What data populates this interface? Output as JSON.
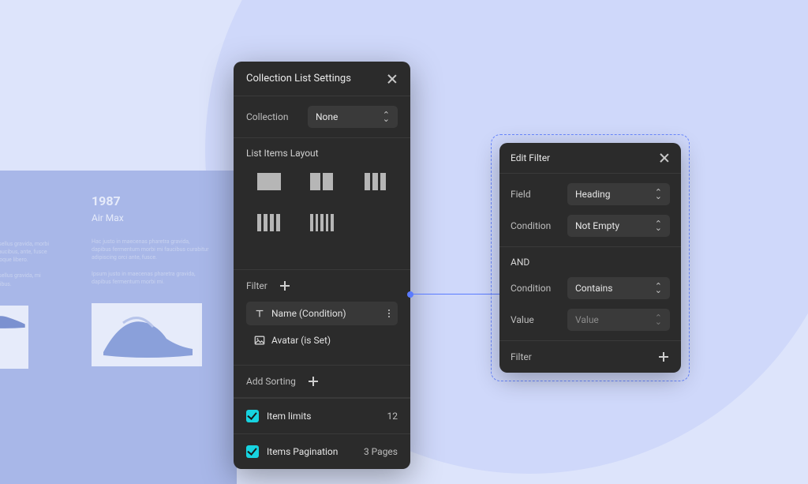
{
  "background": {
    "left_pane": {
      "year": "1987",
      "product": "Air Max",
      "col1_blurb": "Phasellus gravida, morbi mi faucibus, ante, fusce mi soque libero.",
      "col1_blurb2": "Phasellus gravida, mi faucibus.",
      "col2_blurb": "Hac justo in maecenas pharetra gravida, dapibus fermentum morbi mi faucibus curabitur adipiscing orci ante, fusce.",
      "col2_blurb2": "Ipsum justo in maecenas pharetra gravida, dapibus fermentum morbi mi."
    }
  },
  "settings_panel": {
    "title": "Collection List Settings",
    "collection": {
      "label": "Collection",
      "value": "None"
    },
    "list_layout": {
      "label": "List Items Layout"
    },
    "filter": {
      "label": "Filter",
      "items": [
        {
          "icon": "text",
          "label": "Name (Condition)",
          "menu": true
        },
        {
          "icon": "image",
          "label": "Avatar (is Set)",
          "menu": false
        }
      ]
    },
    "sorting": {
      "label": "Add Sorting"
    },
    "item_limits": {
      "label": "Item limits",
      "value": "12"
    },
    "pagination": {
      "label": "Items Pagination",
      "value": "3 Pages"
    }
  },
  "edit_filter": {
    "title": "Edit Filter",
    "field": {
      "label": "Field",
      "value": "Heading"
    },
    "condition1": {
      "label": "Condition",
      "value": "Not Empty"
    },
    "operator": "AND",
    "condition2": {
      "label": "Condition",
      "value": "Contains"
    },
    "value": {
      "label": "Value",
      "placeholder": "Value"
    },
    "footer": {
      "label": "Filter"
    }
  }
}
